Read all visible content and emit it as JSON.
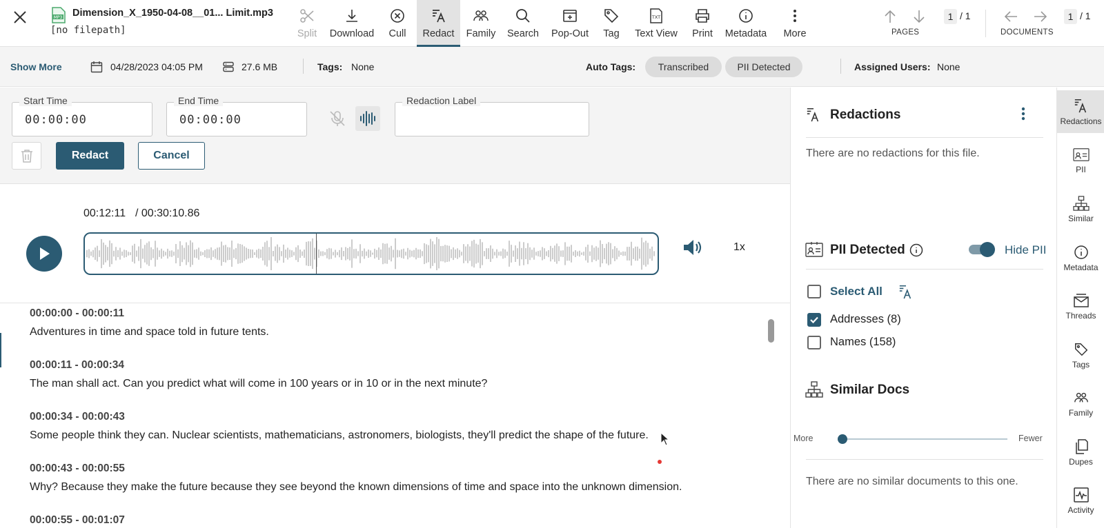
{
  "file": {
    "icon_text": "MP3",
    "name": "Dimension_X_1950-04-08__01... Limit.mp3",
    "path": "[no filepath]"
  },
  "toolbar": [
    {
      "label": "Split",
      "icon": "scissors-icon",
      "disabled": true
    },
    {
      "label": "Download",
      "icon": "download-icon"
    },
    {
      "label": "Cull",
      "icon": "cull-x-circle-icon"
    },
    {
      "label": "Redact",
      "icon": "redact-icon",
      "active": true
    },
    {
      "label": "Family",
      "icon": "family-icon"
    },
    {
      "label": "Search",
      "icon": "search-icon"
    },
    {
      "label": "Pop-Out",
      "icon": "pop-out-icon"
    },
    {
      "label": "Tag",
      "icon": "tag-icon"
    },
    {
      "label": "Text View",
      "icon": "text-view-icon",
      "icon_text": "TXT"
    },
    {
      "label": "Print",
      "icon": "print-icon"
    },
    {
      "label": "Metadata",
      "icon": "info-icon"
    },
    {
      "label": "More",
      "icon": "more-vertical-icon"
    }
  ],
  "pages": {
    "current": "1",
    "total": "/ 1",
    "label": "PAGES"
  },
  "documents": {
    "current": "1",
    "total": "/ 1",
    "label": "DOCUMENTS"
  },
  "info": {
    "show_more": "Show More",
    "date": "04/28/2023 04:05 PM",
    "size": "27.6 MB",
    "tags_label": "Tags:",
    "tags_value": "None",
    "auto_tags_label": "Auto Tags:",
    "auto_tags": [
      "Transcribed",
      "PII Detected"
    ],
    "assigned_label": "Assigned Users:",
    "assigned_value": "None"
  },
  "redaction_form": {
    "start_label": "Start Time",
    "start_value": "00:00:00",
    "end_label": "End Time",
    "end_value": "00:00:00",
    "label_label": "Redaction Label",
    "label_value": "",
    "redact_button": "Redact",
    "cancel_button": "Cancel"
  },
  "player": {
    "current_time": "00:12:11",
    "total_time": "/ 00:30:10.86",
    "speed": "1x",
    "progress": 0.4036
  },
  "transcript": [
    {
      "time": "00:00:00 - 00:00:11",
      "text": "Adventures in time and space told in future tents."
    },
    {
      "time": "00:00:11 - 00:00:34",
      "text": "The man shall act. Can you predict what will come in 100 years or in 10 or in the next minute?"
    },
    {
      "time": "00:00:34 - 00:00:43",
      "text": "Some people think they can. Nuclear scientists, mathematicians, astronomers, biologists, they'll predict the shape of the future."
    },
    {
      "time": "00:00:43 - 00:00:55",
      "text": "Why? Because they make the future because they see beyond the known dimensions of time and space into the unknown dimension."
    },
    {
      "time": "00:00:55 - 00:01:07",
      "text": ""
    }
  ],
  "panel": {
    "redactions_title": "Redactions",
    "redactions_empty": "There are no redactions for this file.",
    "pii_title": "PII Detected",
    "hide_pii_label": "Hide PII",
    "select_all": "Select All",
    "pii_items": [
      {
        "label": "Addresses (8)",
        "checked": true
      },
      {
        "label": "Names (158)",
        "checked": false
      }
    ],
    "similar_title": "Similar Docs",
    "slider_more": "More",
    "slider_fewer": "Fewer",
    "slider_level": 0,
    "similar_empty": "There are no similar documents to this one."
  },
  "rail": [
    {
      "label": "Redactions",
      "icon": "redact-icon",
      "active": true
    },
    {
      "label": "PII",
      "icon": "pii-icon"
    },
    {
      "label": "Similar",
      "icon": "similar-icon"
    },
    {
      "label": "Metadata",
      "icon": "info-icon"
    },
    {
      "label": "Threads",
      "icon": "threads-icon"
    },
    {
      "label": "Tags",
      "icon": "tag-icon"
    },
    {
      "label": "Family",
      "icon": "family-icon"
    },
    {
      "label": "Dupes",
      "icon": "dupes-icon"
    },
    {
      "label": "Activity",
      "icon": "activity-icon"
    }
  ],
  "colors": {
    "accent": "#2b5b73",
    "pill": "#dcdcdc",
    "band": "#f4f4f4"
  }
}
